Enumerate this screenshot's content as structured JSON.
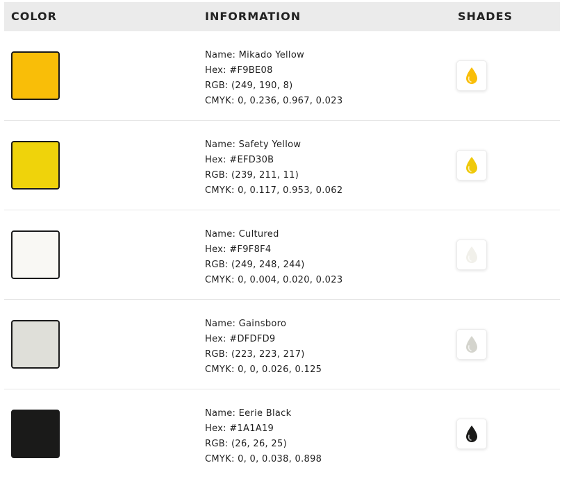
{
  "header": {
    "color": "COLOR",
    "information": "INFORMATION",
    "shades": "SHADES"
  },
  "colors": [
    {
      "hex_value": "#F9BE08",
      "drop_color": "#F9BE08",
      "name": "Name: Mikado Yellow",
      "hex": "Hex: #F9BE08",
      "rgb": "RGB: (249, 190, 8)",
      "cmyk": "CMYK: 0, 0.236, 0.967, 0.023"
    },
    {
      "hex_value": "#EFD30B",
      "drop_color": "#EFC90B",
      "name": "Name: Safety Yellow",
      "hex": "Hex: #EFD30B",
      "rgb": "RGB: (239, 211, 11)",
      "cmyk": "CMYK: 0, 0.117, 0.953, 0.062"
    },
    {
      "hex_value": "#F9F8F4",
      "drop_color": "#F1F0EA",
      "name": "Name: Cultured",
      "hex": "Hex: #F9F8F4",
      "rgb": "RGB: (249, 248, 244)",
      "cmyk": "CMYK: 0, 0.004, 0.020, 0.023"
    },
    {
      "hex_value": "#DFDFD9",
      "drop_color": "#D4D4CD",
      "name": "Name: Gainsboro",
      "hex": "Hex: #DFDFD9",
      "rgb": "RGB: (223, 223, 217)",
      "cmyk": "CMYK: 0, 0, 0.026, 0.125"
    },
    {
      "hex_value": "#1A1A19",
      "drop_color": "#1A1A19",
      "name": "Name: Eerie Black",
      "hex": "Hex: #1A1A19",
      "rgb": "RGB: (26, 26, 25)",
      "cmyk": "CMYK: 0, 0, 0.038, 0.898"
    }
  ],
  "icons": {
    "shade": "water-drop-icon"
  }
}
